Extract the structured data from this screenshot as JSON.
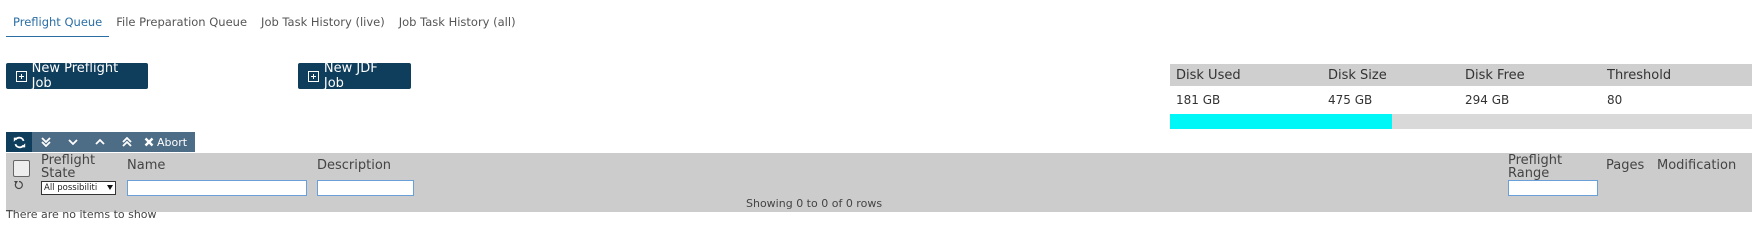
{
  "tabs": [
    {
      "label": "Preflight Queue",
      "active": true
    },
    {
      "label": "File Preparation Queue",
      "active": false
    },
    {
      "label": "Job Task History (live)",
      "active": false
    },
    {
      "label": "Job Task History (all)",
      "active": false
    }
  ],
  "buttons": {
    "new_preflight_job": "New Preflight Job",
    "new_jdf_job": "New JDF Job"
  },
  "disk": {
    "headers": [
      "Disk Used",
      "Disk Size",
      "Disk Free",
      "Threshold"
    ],
    "values": [
      "181 GB",
      "475 GB",
      "294 GB",
      "80"
    ],
    "usage_fraction": 0.381,
    "bar_color": "#00f7f7"
  },
  "toolbar": {
    "icons": [
      "refresh-icon",
      "double-chevron-down-icon",
      "chevron-down-icon",
      "chevron-up-icon",
      "double-chevron-up-icon"
    ],
    "abort_label": "Abort"
  },
  "grid": {
    "columns": {
      "preflight_state": "Preflight State",
      "name": "Name",
      "description": "Description",
      "preflight_range": "Preflight Range",
      "pages": "Pages",
      "modification": "Modification"
    },
    "state_filter_value": "All possibiliti",
    "rows_info": "Showing 0 to 0 of 0 rows",
    "empty_message": "There are no items to show"
  },
  "colors": {
    "primary": "#0f3d5c",
    "toolbar": "#4d6c85",
    "header_bg": "#cccccc"
  }
}
